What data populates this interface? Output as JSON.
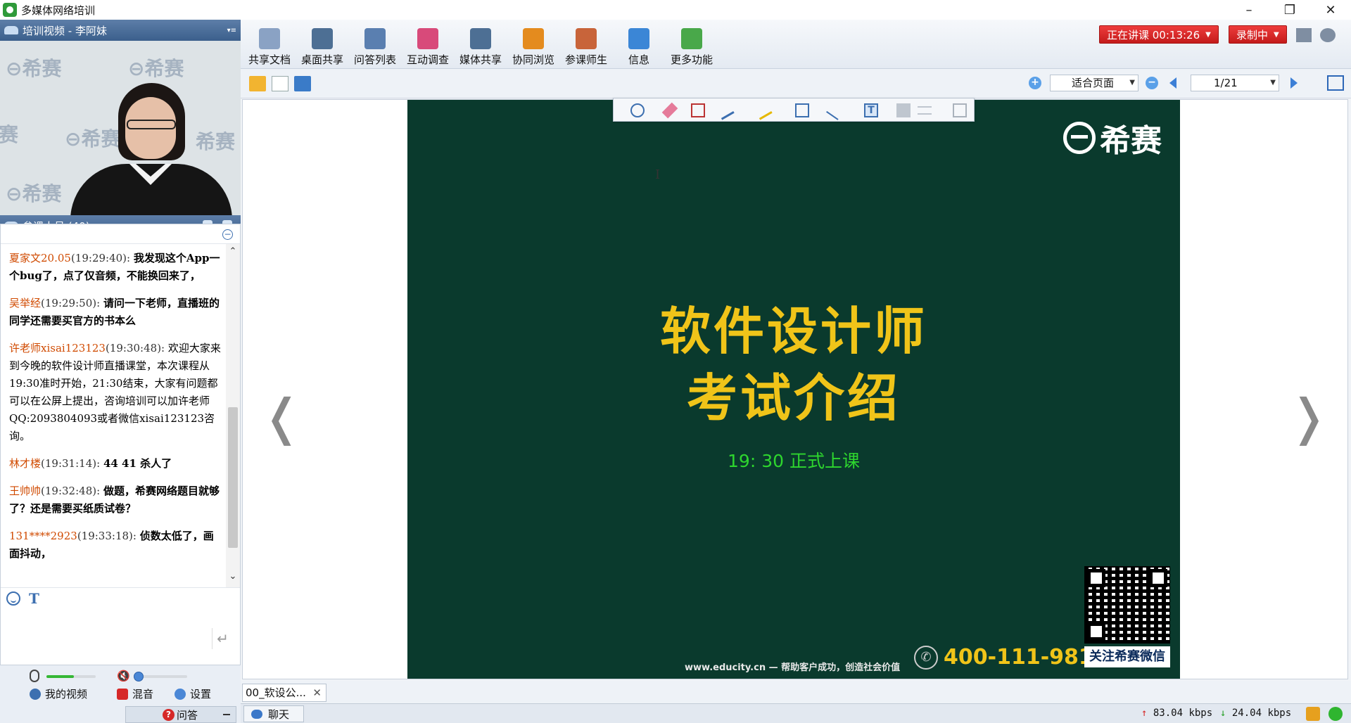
{
  "window": {
    "title": "多媒体网络培训",
    "controls": [
      "minimize",
      "restore",
      "close"
    ]
  },
  "video_panel": {
    "header": "培训视频 - 李阿妹",
    "watermark_text": "希赛"
  },
  "attendees": {
    "label": "参课人员 (40)"
  },
  "chat": {
    "messages": [
      {
        "sender": "夏家文20.05",
        "time": "(19:29:40):",
        "text": "我发现这个App一个bug了，点了仅音频，不能换回来了，",
        "bold": true
      },
      {
        "sender": "吴举经",
        "time": "(19:29:50):",
        "text": "请问一下老师，直播班的同学还需要买官方的书本么",
        "bold": true
      },
      {
        "sender": "许老师xisai123123",
        "time": "(19:30:48):",
        "text": "欢迎大家来到今晚的软件设计师直播课堂，本次课程从19:30准时开始，21:30结束，大家有问题都可以在公屏上提出，咨询培训可以加许老师QQ:2093804093或者微信xisai123123咨询。",
        "bold": false
      },
      {
        "sender": "林才楼",
        "time": "(19:31:14):",
        "text": "44 41 杀人了",
        "bold": true
      },
      {
        "sender": "王帅帅",
        "time": "(19:32:48):",
        "text": "做题，希赛网络题目就够了？还是需要买纸质试卷？",
        "bold": true
      },
      {
        "sender": "131****2923",
        "time": "(19:33:18):",
        "text": "侦数太低了，画面抖动，",
        "bold": true
      }
    ],
    "input_value": ""
  },
  "av_controls": {
    "mic_level": 0.55,
    "speaker_level": 0.0,
    "my_video_label": "我的视频",
    "mix_label": "混音",
    "settings_label": "设置"
  },
  "bottom_left_tab": {
    "label": "问答"
  },
  "toolbar": {
    "items": [
      {
        "label": "共享文档",
        "icon": "shared-doc-icon",
        "color": "#8aa2c4"
      },
      {
        "label": "桌面共享",
        "icon": "desktop-share-icon",
        "color": "#4d6f94"
      },
      {
        "label": "问答列表",
        "icon": "qa-list-icon",
        "color": "#5a7fb0"
      },
      {
        "label": "互动调查",
        "icon": "survey-icon",
        "color": "#d84a7a"
      },
      {
        "label": "媒体共享",
        "icon": "media-share-icon",
        "color": "#4d6f94"
      },
      {
        "label": "协同浏览",
        "icon": "co-browse-icon",
        "color": "#e48b1e"
      },
      {
        "label": "参课师生",
        "icon": "participants-icon",
        "color": "#c8643a"
      },
      {
        "label": "信息",
        "icon": "info-icon",
        "color": "#3b86d6"
      },
      {
        "label": "更多功能",
        "icon": "more-features-icon",
        "color": "#49a84a"
      }
    ],
    "lecture_status": "正在讲课 00:13:26",
    "recording_status": "录制中"
  },
  "subbar": {
    "zoom_mode": "适合页面",
    "page": "1/21"
  },
  "slide": {
    "logo": "希赛",
    "title_line1": "软件设计师",
    "title_line2": "考试介绍",
    "subtitle": "19: 30 正式上课",
    "phone": "400-111-9811",
    "qr_caption": "关注希赛微信",
    "website": "www.educity.cn — 帮助客户成功，创造社会价值"
  },
  "doc_tab": {
    "label": "00_软设公..."
  },
  "statusbar": {
    "chat_tab": "聊天",
    "upload": "83.04 kbps",
    "download": "24.04 kbps"
  },
  "colors": {
    "accent_red": "#d62828",
    "slide_bg": "#0a3a2d",
    "slide_title": "#f0c419",
    "slide_subtitle": "#2ed62e",
    "chat_sender": "#d04a00"
  }
}
